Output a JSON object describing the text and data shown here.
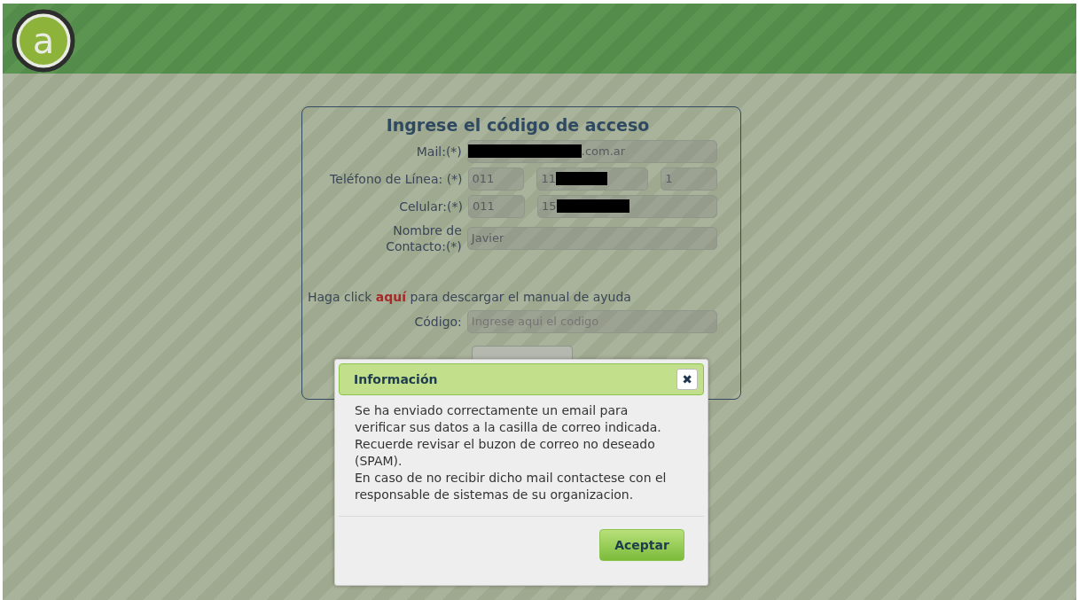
{
  "header": {
    "logo_letter": "a"
  },
  "form": {
    "title": "Ingrese el código de acceso",
    "rows": [
      {
        "label": "Mail:(*)",
        "fields": [
          {
            "text": ".com.ar",
            "redacted": true
          }
        ]
      },
      {
        "label": "Teléfono de Línea: (*)",
        "fields": [
          {
            "text": "011",
            "redacted": false
          },
          {
            "text": "11",
            "redacted": true
          },
          {
            "text": "1",
            "redacted": false
          }
        ]
      },
      {
        "label": "Celular:(*)",
        "fields": [
          {
            "text": "011",
            "redacted": false
          },
          {
            "text": "15",
            "redacted": true
          }
        ]
      },
      {
        "label": [
          "Nombre de",
          "Contacto:(*)"
        ],
        "fields": [
          {
            "text": "Javier",
            "redacted": false
          }
        ]
      }
    ],
    "help_text": "Haga click **aquí** para descargar el manual de ayuda",
    "code_label": "Código:",
    "code_placeholder": "Ingrese aqui el codigo"
  },
  "dialog": {
    "title": "Información",
    "close": "✖",
    "message": [
      "Se ha enviado correctamente un email para verificar sus datos a la casilla de correo indicada.",
      "Recuerde revisar el buzon de correo no deseado (SPAM).",
      "En caso de no recibir dicho mail contactese con el responsable de sistemas de su organizacion."
    ],
    "button": "Aceptar"
  }
}
